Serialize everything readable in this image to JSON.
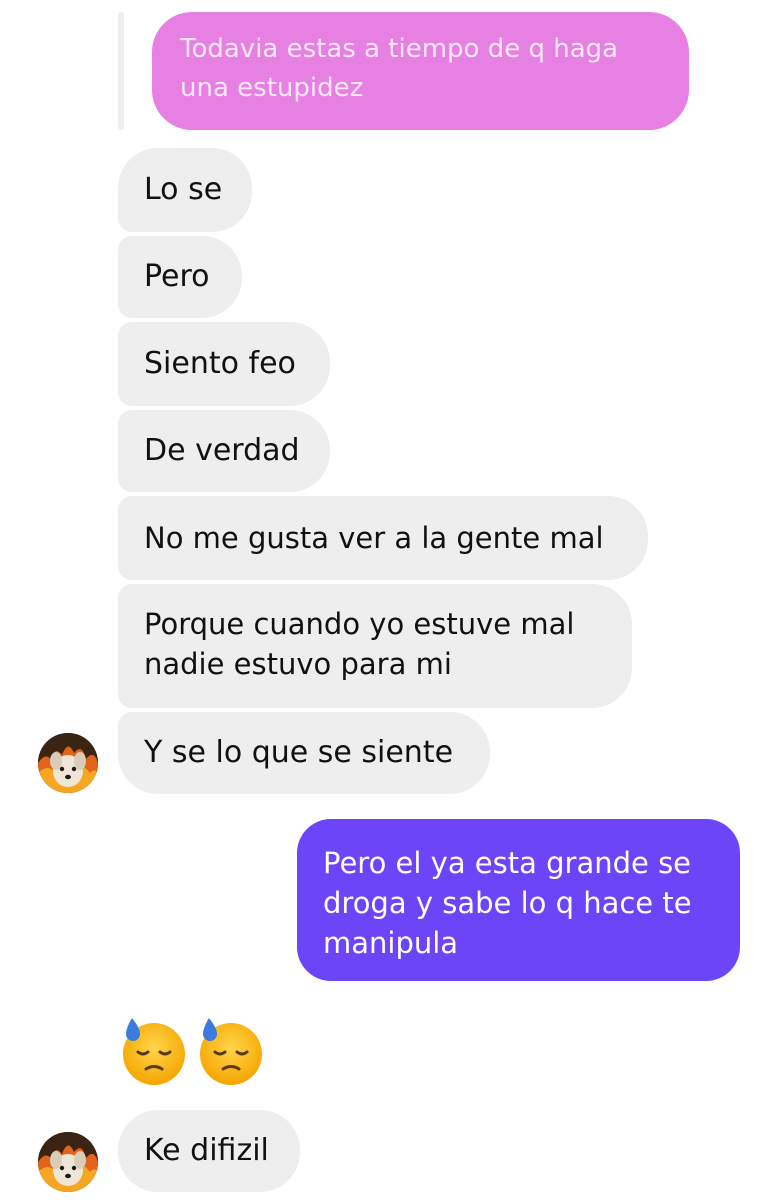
{
  "chat": {
    "quoted_reply": "Todavia estas a tiempo de q haga una estupidez",
    "incoming_group_1": [
      "Lo se",
      "Pero",
      "Siento feo",
      "De verdad",
      "No me gusta ver a la gente mal",
      "Porque cuando yo estuve mal\nnadie estuvo para mi",
      "Y se lo que se siente"
    ],
    "outgoing_message": "Pero el ya esta grande se droga y sabe lo q hace te manipula",
    "reaction_emojis": [
      "downcast-face-with-sweat-emoji",
      "downcast-face-with-sweat-emoji"
    ],
    "incoming_last": "Ke difizil"
  },
  "colors": {
    "quoted_bubble": "#e681e3",
    "incoming_bubble": "#eeeeee",
    "outgoing_bubble": "#6b45f7"
  },
  "icons": {
    "avatar": "contact-avatar-dog-fire",
    "emoji": "downcast-face-with-sweat"
  }
}
